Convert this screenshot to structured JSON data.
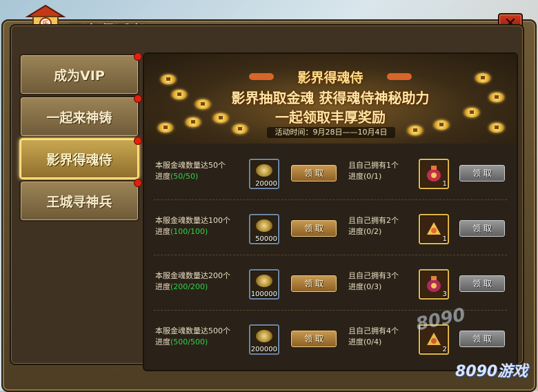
{
  "window": {
    "title": "玩家俱乐部"
  },
  "sidebar": {
    "items": [
      {
        "label": "成为VIP",
        "active": false,
        "badge": true
      },
      {
        "label": "一起来神铸",
        "active": false,
        "badge": true
      },
      {
        "label": "影界得魂侍",
        "active": true,
        "badge": true
      },
      {
        "label": "王城寻神兵",
        "active": false,
        "badge": true
      }
    ]
  },
  "banner": {
    "line1": "影界得魂侍",
    "line2": "影界抽取金魂 获得魂侍神秘助力",
    "line3": "一起领取丰厚奖励",
    "period": "活动时间：9月28日——10月4日"
  },
  "rewards": [
    {
      "condition": "本服金魂数量达50个",
      "progress_label": "进度",
      "progress": "(50/50)",
      "reward_count": "20000",
      "claim_label": "领 取",
      "own_condition": "且自己拥有1个",
      "own_progress": "进度(0/1)",
      "own_count": "1",
      "own_claim_label": "领 取"
    },
    {
      "condition": "本服金魂数量达100个",
      "progress_label": "进度",
      "progress": "(100/100)",
      "reward_count": "50000",
      "claim_label": "领 取",
      "own_condition": "且自己拥有2个",
      "own_progress": "进度(0/2)",
      "own_count": "1",
      "own_claim_label": "领 取"
    },
    {
      "condition": "本服金魂数量达200个",
      "progress_label": "进度",
      "progress": "(200/200)",
      "reward_count": "100000",
      "claim_label": "领 取",
      "own_condition": "且自己拥有3个",
      "own_progress": "进度(0/3)",
      "own_count": "3",
      "own_claim_label": "领 取"
    },
    {
      "condition": "本服金魂数量达500个",
      "progress_label": "进度",
      "progress": "(500/500)",
      "reward_count": "200000",
      "claim_label": "领 取",
      "own_condition": "且自己拥有4个",
      "own_progress": "进度(0/4)",
      "own_count": "2",
      "own_claim_label": "领 取"
    }
  ],
  "colors": {
    "accent_gold": "#f6d66c",
    "progress_green": "#2fd24a",
    "close_red": "#cf3a20"
  },
  "icons": [
    "pavilion-icon",
    "close-icon",
    "gold-soul-icon",
    "gift-bag-icon"
  ],
  "watermark": {
    "text": "8090",
    "text2": "游戏"
  }
}
